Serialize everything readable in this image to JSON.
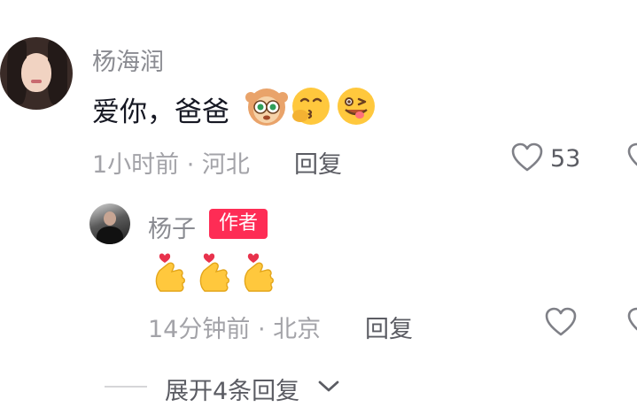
{
  "comment": {
    "username": "杨海润",
    "text": "爱你，爸爸",
    "time_location": "1小时前 · 河北",
    "reply_label": "回复",
    "like_count": "53",
    "emojis": [
      "monkey-emoji",
      "kiss-emoji",
      "wink-tongue-emoji"
    ]
  },
  "reply": {
    "username": "杨子",
    "badge": "作者",
    "emojis": [
      "finger-heart-emoji",
      "finger-heart-emoji",
      "finger-heart-emoji"
    ],
    "time_location": "14分钟前 · 北京",
    "reply_label": "回复"
  },
  "expand": {
    "label": "展开4条回复"
  },
  "colors": {
    "badge_bg": "#fe2c55",
    "text_primary": "#161823",
    "text_secondary": "#8a8b91",
    "text_meta": "#a3a3a8"
  }
}
